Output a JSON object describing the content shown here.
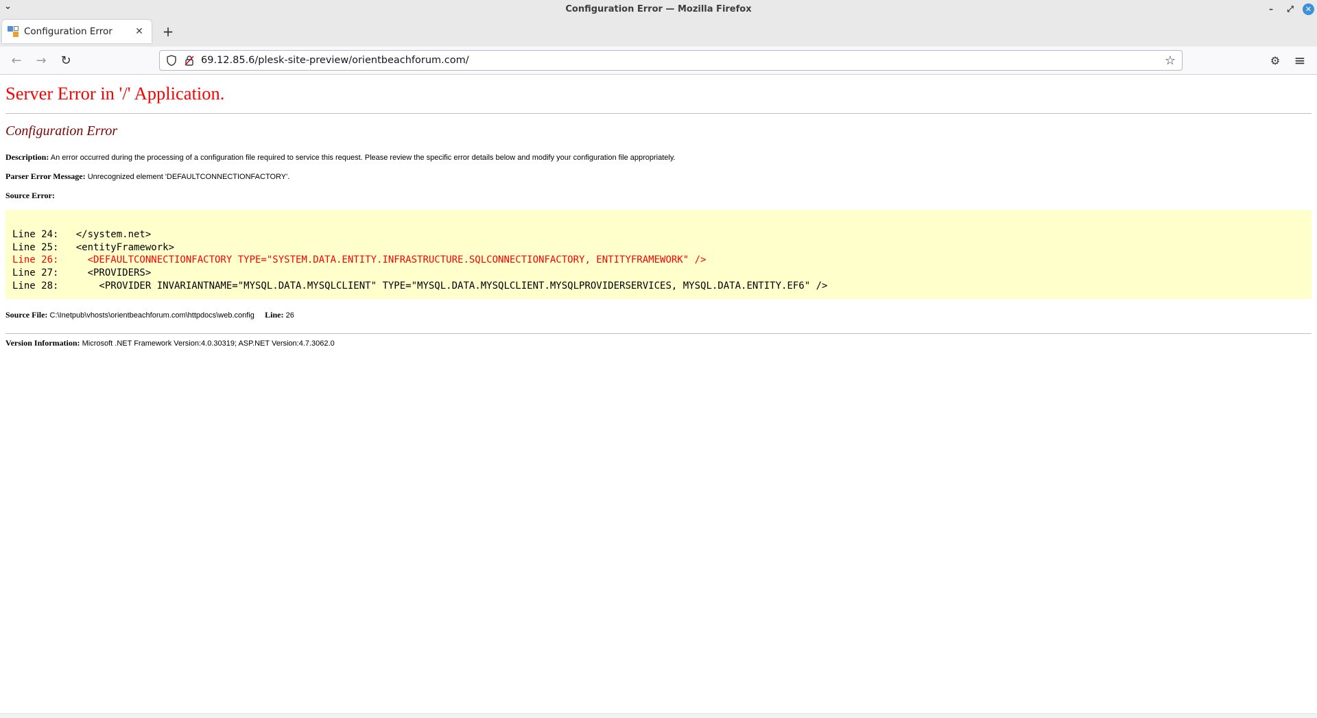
{
  "window": {
    "title": "Configuration Error — Mozilla Firefox",
    "menu_icon": "chevron-down-icon",
    "controls": {
      "minimize": "–",
      "maximize": "⤢",
      "close": "✕"
    }
  },
  "tabs": [
    {
      "label": "Configuration Error",
      "close_glyph": "✕",
      "active": true
    }
  ],
  "newtab_glyph": "+",
  "nav": {
    "back": "←",
    "forward": "→",
    "reload": "↻",
    "url": "69.12.85.6/plesk-site-preview/orientbeachforum.com/",
    "bookmark_glyph": "☆",
    "extensions_glyph": "⚙",
    "menu_glyph": "≡"
  },
  "page": {
    "heading": "Server Error in '/' Application.",
    "subheading": "Configuration Error",
    "description_label": "Description:",
    "description": "An error occurred during the processing of a configuration file required to service this request. Please review the specific error details below and modify your configuration file appropriately.",
    "parser_label": "Parser Error Message:",
    "parser_message": "Unrecognized element 'DEFAULTCONNECTIONFACTORY'.",
    "source_error_label": "Source Error:",
    "source_lines": [
      {
        "text": "Line 24:   </system.net>",
        "error": false
      },
      {
        "text": "Line 25:   <entityFramework>",
        "error": false
      },
      {
        "text": "Line 26:     <DEFAULTCONNECTIONFACTORY TYPE=\"SYSTEM.DATA.ENTITY.INFRASTRUCTURE.SQLCONNECTIONFACTORY, ENTITYFRAMEWORK\" />",
        "error": true
      },
      {
        "text": "Line 27:     <PROVIDERS>",
        "error": false
      },
      {
        "text": "Line 28:       <PROVIDER INVARIANTNAME=\"MYSQL.DATA.MYSQLCLIENT\" TYPE=\"MYSQL.DATA.MYSQLCLIENT.MYSQLPROVIDERSERVICES, MYSQL.DATA.ENTITY.EF6\" />",
        "error": false
      }
    ],
    "source_file_label": "Source File:",
    "source_file": "C:\\Inetpub\\vhosts\\orientbeachforum.com\\httpdocs\\web.config",
    "line_label": "Line:",
    "line_number": "26",
    "version_label": "Version Information:",
    "version": "Microsoft .NET Framework Version:4.0.30319; ASP.NET Version:4.7.3062.0"
  },
  "colors": {
    "heading": "#ff0000",
    "subheading": "#800000",
    "code_background": "#ffffcc",
    "error_line": "#ff0000"
  }
}
